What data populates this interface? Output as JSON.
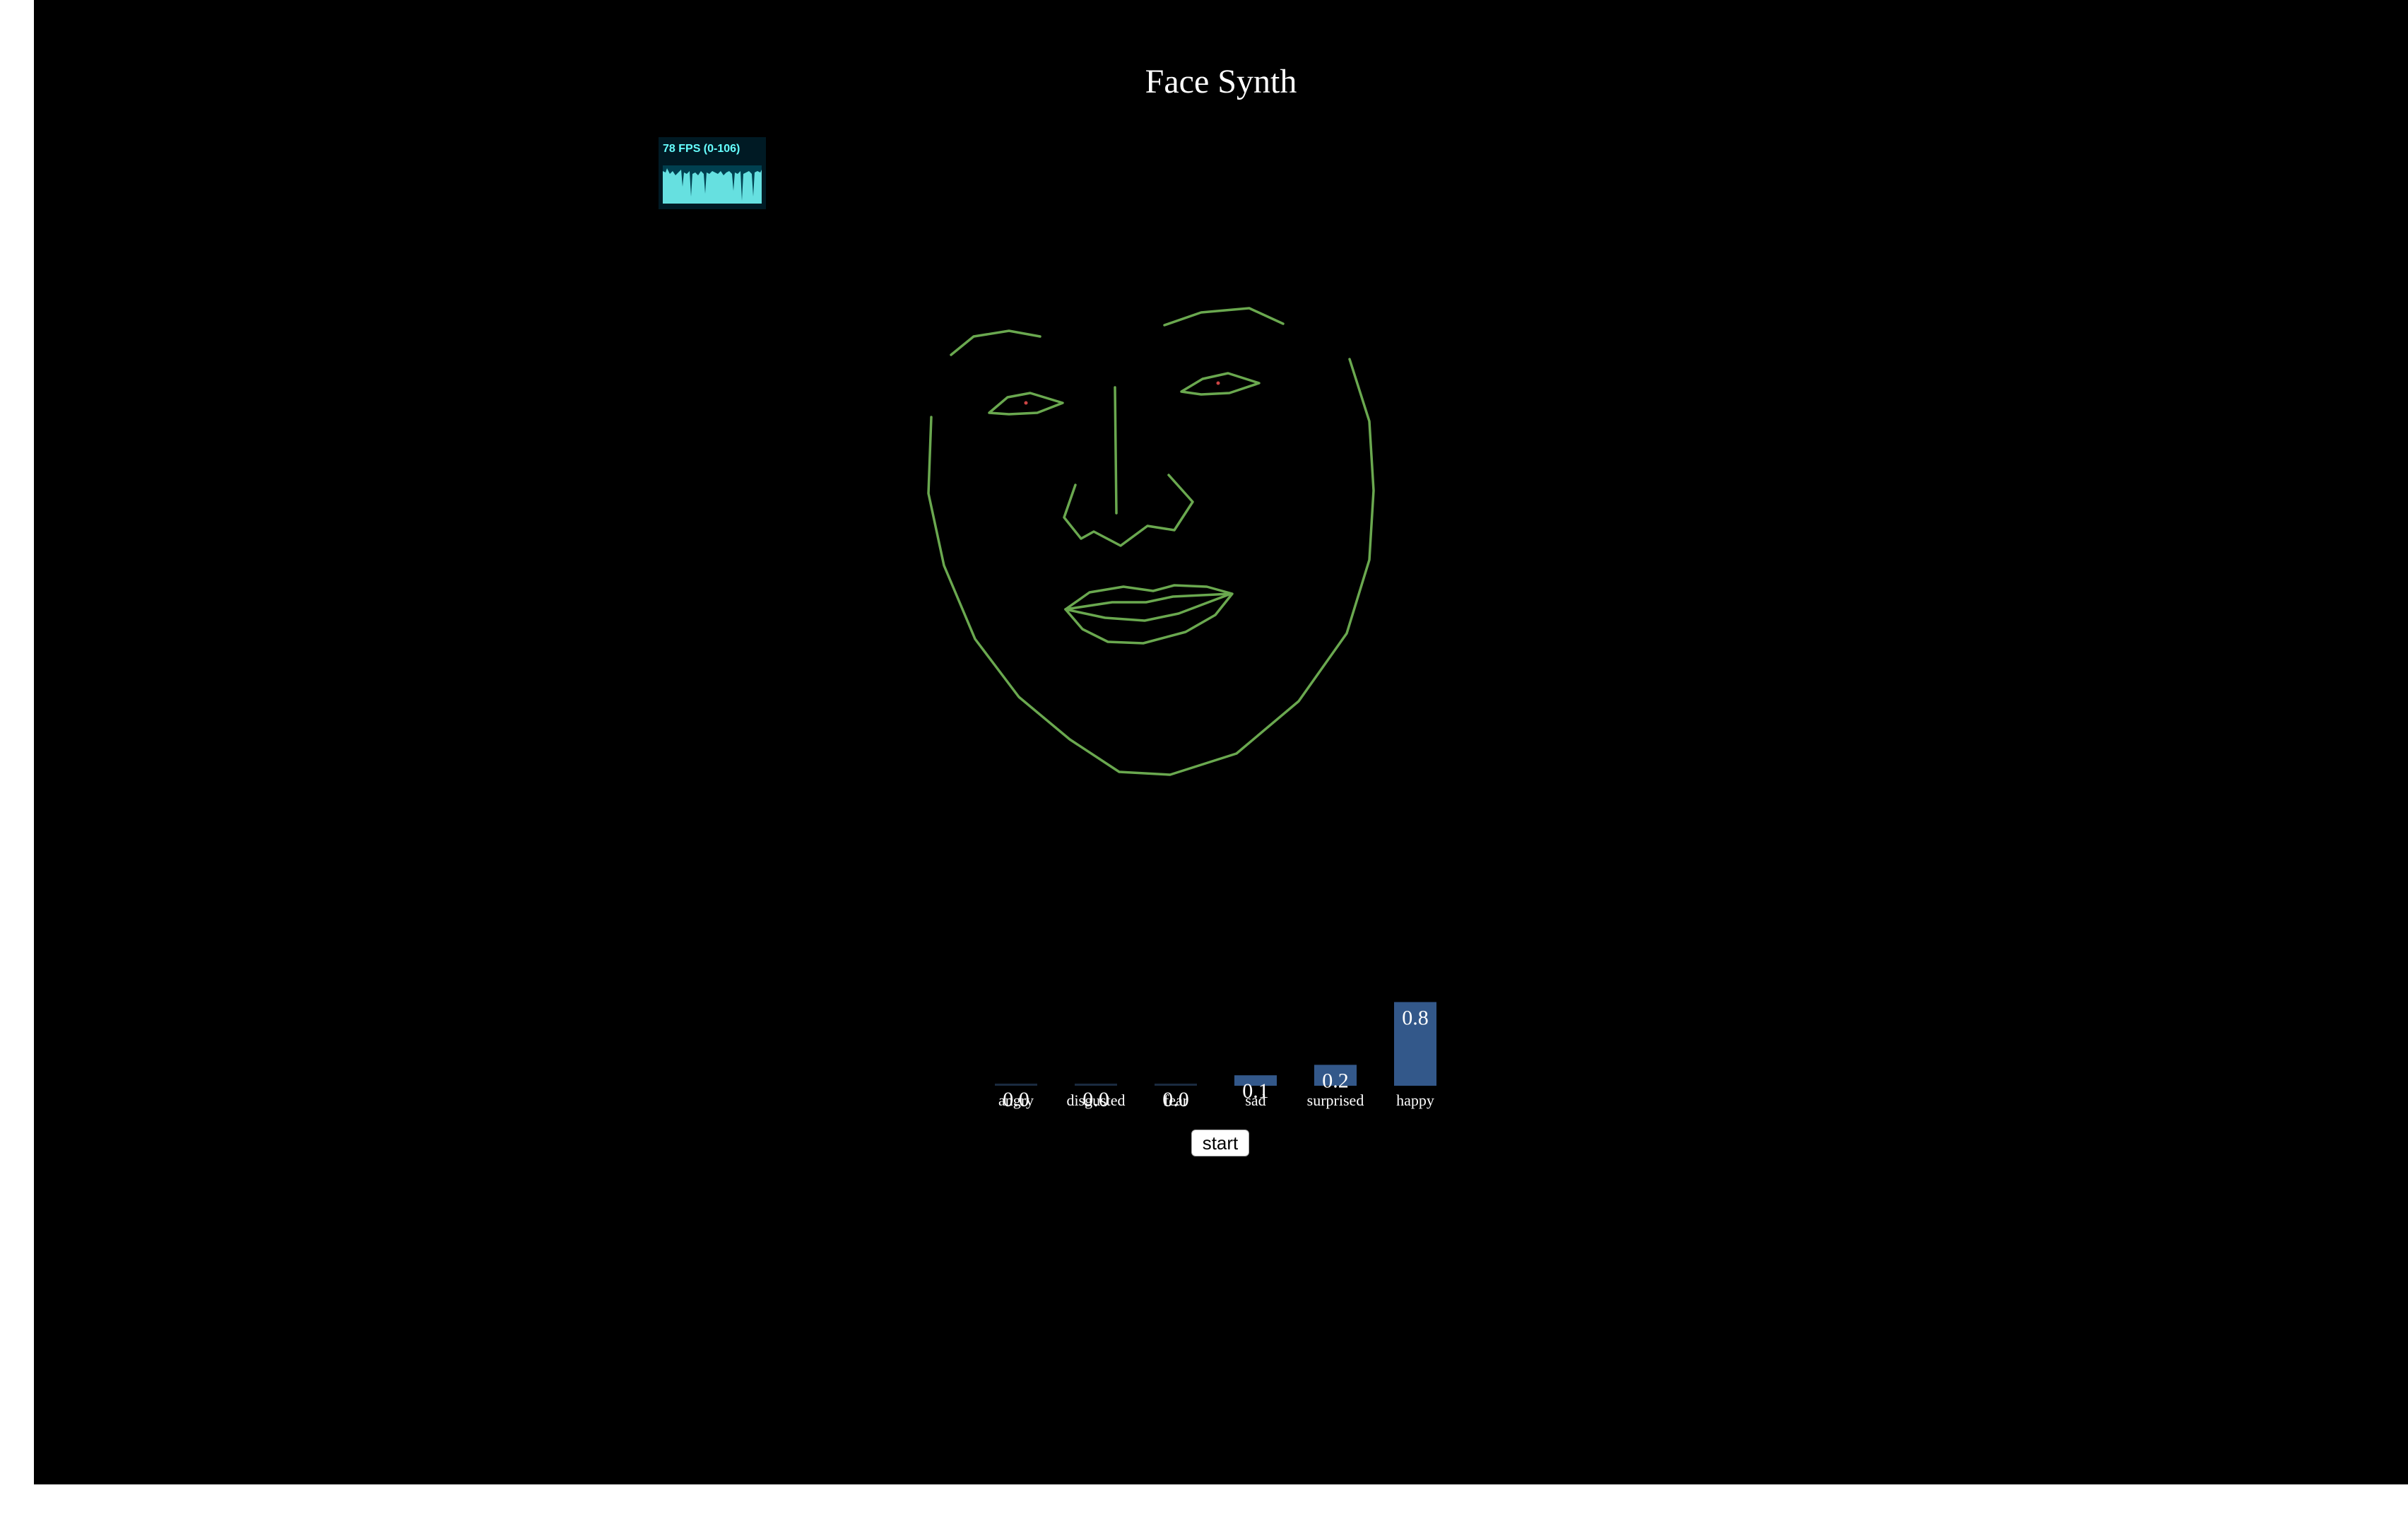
{
  "header": {
    "title": "Face Synth"
  },
  "fps_meter": {
    "label": "78 FPS (0-106)",
    "fg_color": "#66ffff",
    "bg_color": "#001a24"
  },
  "controls": {
    "start_label": "start"
  },
  "colors": {
    "face_lines": "#6aa84f",
    "bar_fill": "#33588a",
    "background": "#000000",
    "text": "#ffffff"
  },
  "chart_data": {
    "type": "bar",
    "categories": [
      "angry",
      "disgusted",
      "fear",
      "sad",
      "surprised",
      "happy"
    ],
    "values": [
      0.0,
      0.0,
      0.0,
      0.1,
      0.2,
      0.8
    ],
    "value_labels": [
      "0.0",
      "0.0",
      "0.0",
      "0.1",
      "0.2",
      "0.8"
    ],
    "ylim": [
      0,
      1
    ]
  }
}
